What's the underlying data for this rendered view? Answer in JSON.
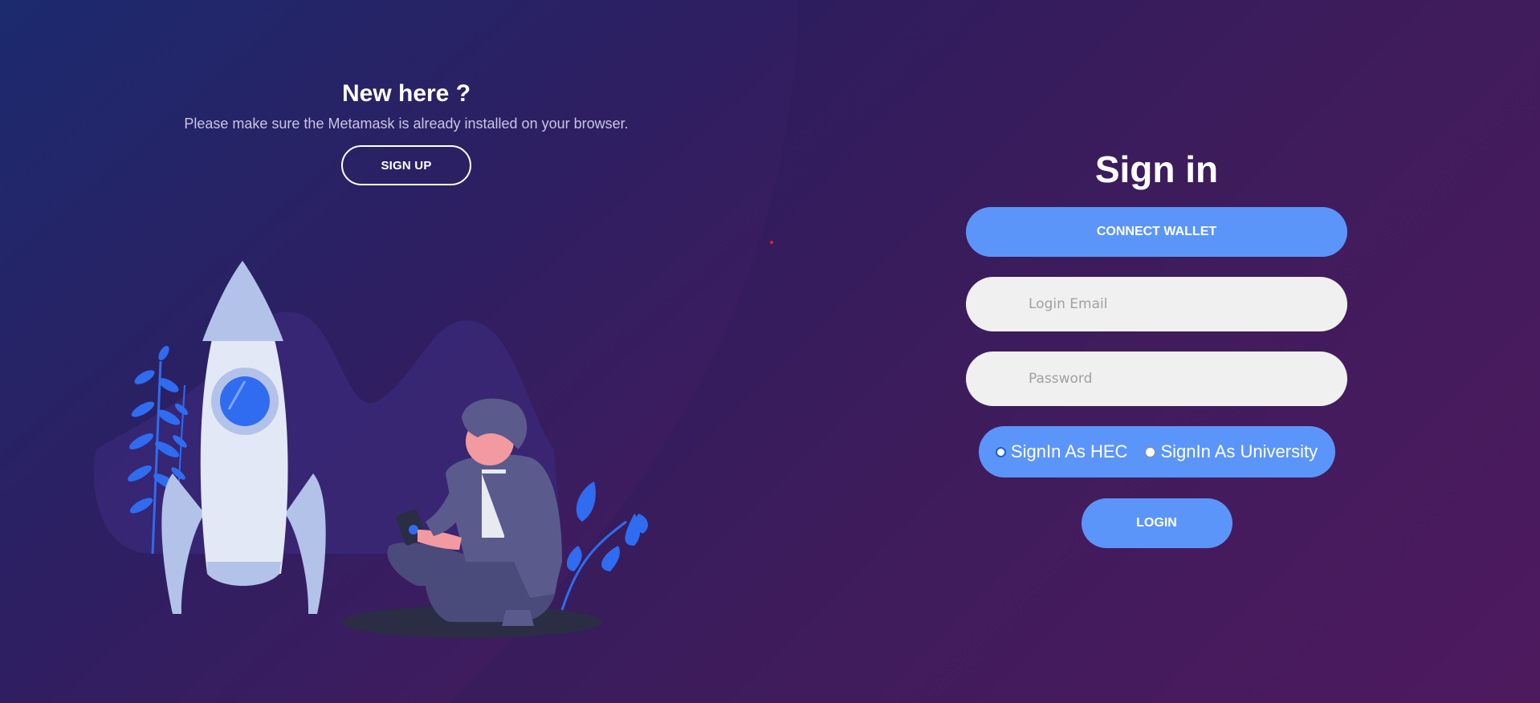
{
  "left_panel": {
    "title": "New here ?",
    "description": "Please make sure the Metamask is already installed on your browser.",
    "signup_label": "SIGN UP"
  },
  "signin": {
    "title": "Sign in",
    "connect_wallet_label": "CONNECT WALLET",
    "email_placeholder": "Login Email",
    "password_placeholder": "Password",
    "role_options": [
      {
        "label": "SignIn As HEC",
        "checked": true
      },
      {
        "label": "SignIn As University",
        "checked": false
      }
    ],
    "login_label": "LOGIN"
  },
  "colors": {
    "accent": "#5b95f9",
    "field_bg": "#f0f0f0",
    "bg_left": "#1a1f5c",
    "bg_right": "#4e1a5e"
  },
  "icons": [
    "rocket-illustration",
    "person-illustration",
    "plant-icon"
  ]
}
